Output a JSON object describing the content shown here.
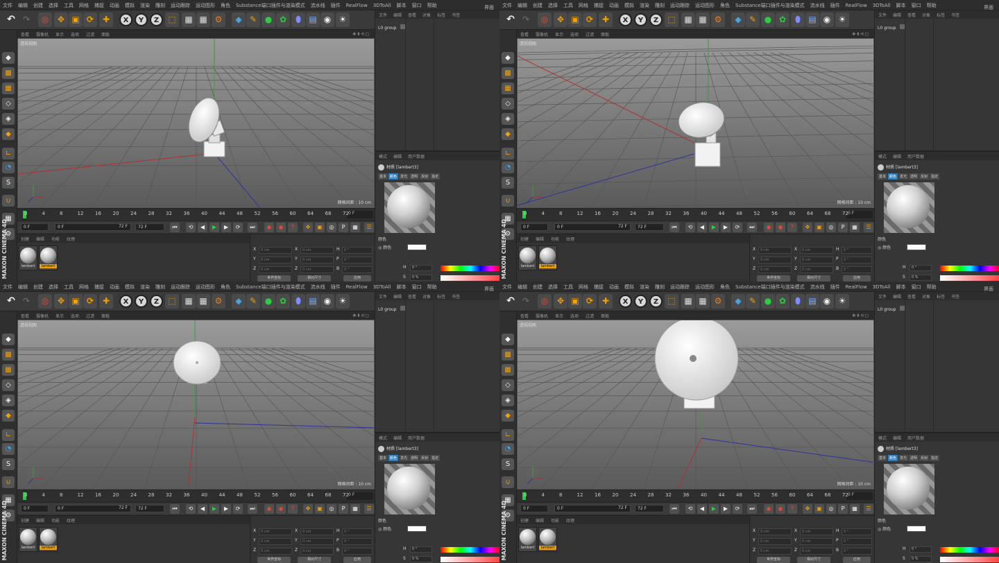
{
  "menu": {
    "items": [
      "文件",
      "编辑",
      "创建",
      "选择",
      "工具",
      "网格",
      "捕捉",
      "动画",
      "模拟",
      "渲染",
      "雕刻",
      "运动跟踪",
      "运动图形",
      "角色",
      "Substance端口插件与渲染模式",
      "流水线",
      "插件",
      "RealFlow",
      "3DToAll",
      "脚本",
      "窗口",
      "帮助"
    ],
    "layout": "界面"
  },
  "toolbar": {
    "x": "X",
    "y": "Y",
    "z": "Z"
  },
  "vp_menu": [
    "查看",
    "摄像机",
    "显示",
    "选项",
    "过滤",
    "面板"
  ],
  "vp_name": "透视视图",
  "grid_text": "网格间距 : 10 cm",
  "timeline": {
    "ticks": [
      "0",
      "4",
      "8",
      "12",
      "16",
      "20",
      "24",
      "28",
      "32",
      "36",
      "40",
      "44",
      "48",
      "52",
      "56",
      "60",
      "64",
      "68",
      "72"
    ],
    "end_field": "0 F",
    "start": "0 F",
    "current": "0 F",
    "end_range": "72 F",
    "end": "72 F"
  },
  "mat_menu": [
    "创建",
    "编辑",
    "功能",
    "纹理"
  ],
  "materials": [
    {
      "label": "lambert"
    },
    {
      "label": "lambert"
    }
  ],
  "coords": {
    "rows": [
      {
        "a": "X",
        "av": "0 cm",
        "b": "X",
        "bv": "0 cm",
        "c": "H",
        "cv": "0 °"
      },
      {
        "a": "Y",
        "av": "0 cm",
        "b": "Y",
        "bv": "0 cm",
        "c": "P",
        "cv": "0 °"
      },
      {
        "a": "Z",
        "av": "0 cm",
        "b": "Z",
        "bv": "0 cm",
        "c": "B",
        "cv": "0 °"
      }
    ],
    "btn1": "世界坐标",
    "btn2": "相对尺寸",
    "apply": "应用"
  },
  "objects": {
    "menu": [
      "文件",
      "编辑",
      "查看",
      "对象",
      "标签",
      "书签"
    ],
    "group": "L0 group"
  },
  "attributes": {
    "menu": [
      "模式",
      "编辑",
      "用户数据"
    ],
    "mat_name": "材质 [lambert3]",
    "tabs": [
      "基本",
      "颜色",
      "发光",
      "透明",
      "反射",
      "指定"
    ],
    "section": "颜色",
    "color_label": "颜色",
    "h_label": "H",
    "h_value": "0 °",
    "s_label": "S",
    "s_value": "0 %"
  },
  "panes": [
    {
      "id": "top-left",
      "view": "side"
    },
    {
      "id": "top-right",
      "view": "angled-side"
    },
    {
      "id": "bottom-left",
      "view": "front"
    },
    {
      "id": "bottom-right",
      "view": "front-close"
    }
  ]
}
